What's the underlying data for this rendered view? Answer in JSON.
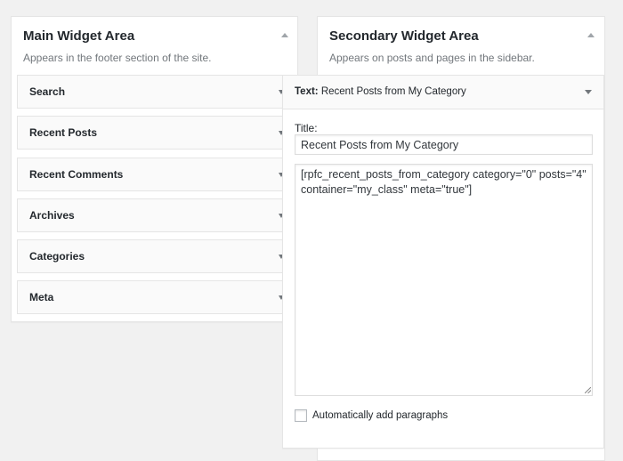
{
  "main_area": {
    "title": "Main Widget Area",
    "description": "Appears in the footer section of the site."
  },
  "secondary_area": {
    "title": "Secondary Widget Area",
    "description": "Appears on posts and pages in the sidebar."
  },
  "widgets": [
    {
      "label": "Search"
    },
    {
      "label": "Recent Posts"
    },
    {
      "label": "Recent Comments"
    },
    {
      "label": "Archives"
    },
    {
      "label": "Categories"
    },
    {
      "label": "Meta"
    }
  ],
  "text_widget": {
    "type_label": "Text:",
    "name": "Recent Posts from My Category",
    "title_label": "Title:",
    "title_value": "Recent Posts from My Category",
    "content": "[rpfc_recent_posts_from_category category=\"0\" posts=\"4\" container=\"my_class\" meta=\"true\"]",
    "autop_label": "Automatically add paragraphs",
    "autop_checked": false
  },
  "colors": {
    "background": "#f1f1f1",
    "panel": "#ffffff",
    "border": "#e5e5e5",
    "text": "#23282d",
    "muted_text": "#72777c"
  },
  "icons": {
    "area_toggle": "triangle-up-icon",
    "widget_expand": "triangle-down-icon"
  }
}
